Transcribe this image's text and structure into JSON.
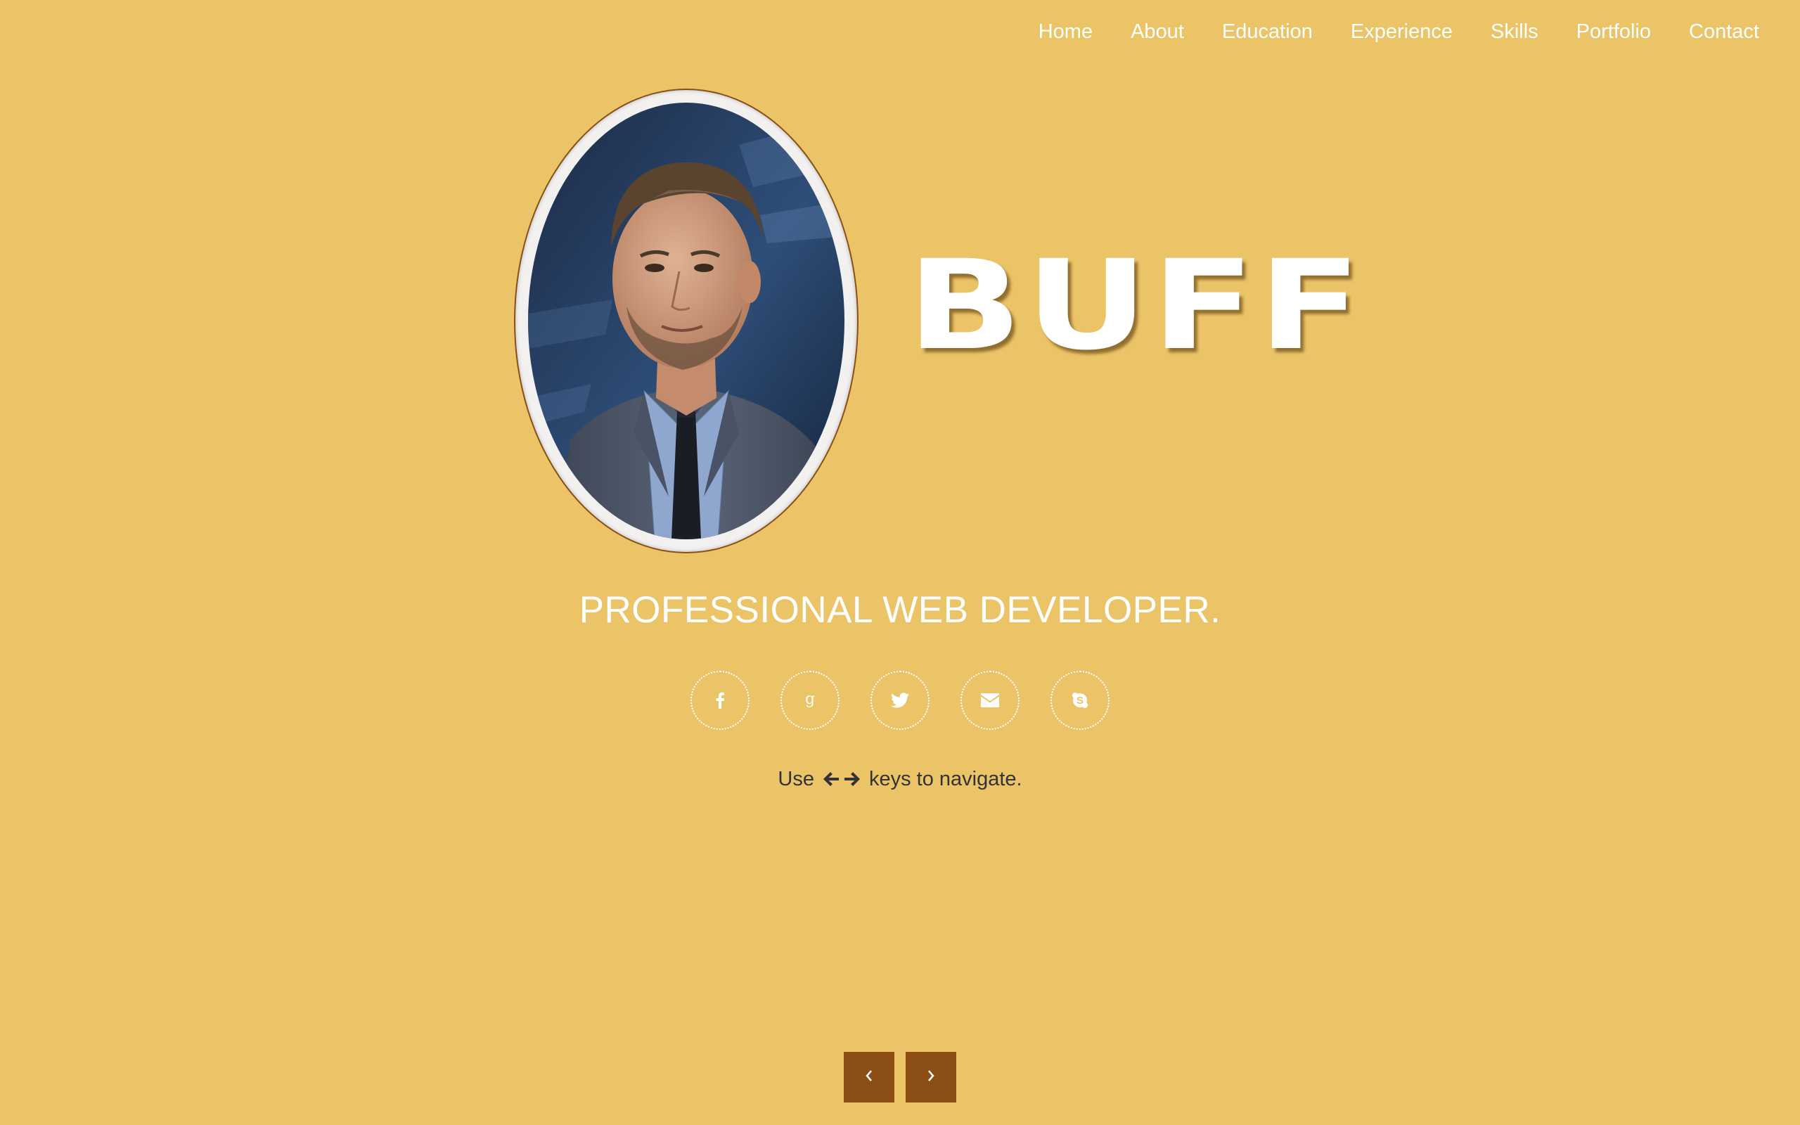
{
  "nav": {
    "items": [
      {
        "label": "Home"
      },
      {
        "label": "About"
      },
      {
        "label": "Education"
      },
      {
        "label": "Experience"
      },
      {
        "label": "Skills"
      },
      {
        "label": "Portfolio"
      },
      {
        "label": "Contact"
      }
    ]
  },
  "hero": {
    "name": "BUFF",
    "tagline": "PROFESSIONAL WEB DEVELOPER."
  },
  "social": {
    "icons": [
      "facebook-icon",
      "google-plus-icon",
      "twitter-icon",
      "envelope-icon",
      "skype-icon"
    ]
  },
  "hint": {
    "prefix": "Use",
    "suffix": "keys to navigate."
  },
  "pager": {
    "prev_icon": "chevron-left-icon",
    "next_icon": "chevron-right-icon"
  },
  "colors": {
    "background": "#ecc468",
    "text_light": "#ffffff",
    "text_dark": "#333333",
    "button": "#8b4f15",
    "frame_border": "#8a4f16"
  }
}
